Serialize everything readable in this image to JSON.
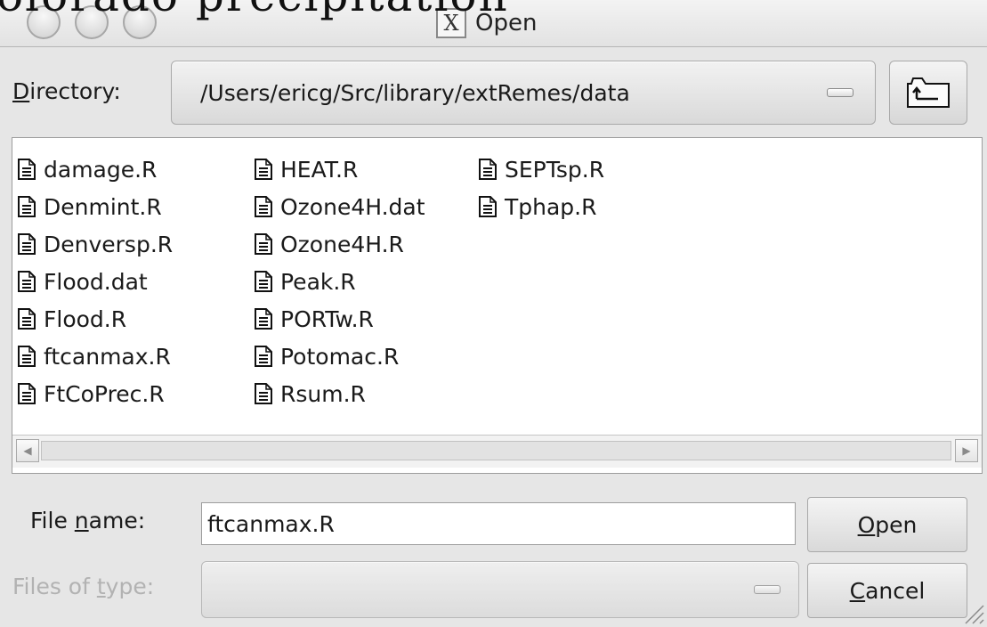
{
  "background_text": "olorado precipitation",
  "window": {
    "title": "Open",
    "title_icon": "x11-icon",
    "title_icon_glyph": "X"
  },
  "directory": {
    "label_mnemonic": "D",
    "label_rest": "irectory:",
    "path": "/Users/ericg/Src/library/extRemes/data",
    "up_button_icon": "folder-up-icon"
  },
  "files": {
    "columns": [
      [
        "damage.R",
        "Denmint.R",
        "Denversp.R",
        "Flood.dat",
        "Flood.R",
        "ftcanmax.R",
        "FtCoPrec.R"
      ],
      [
        "HEAT.R",
        "Ozone4H.dat",
        "Ozone4H.R",
        "Peak.R",
        "PORTw.R",
        "Potomac.R",
        "Rsum.R"
      ],
      [
        "SEPTsp.R",
        "Tphap.R"
      ]
    ]
  },
  "filename": {
    "label_prefix": "File ",
    "label_mnemonic": "n",
    "label_suffix": "ame:",
    "value": "ftcanmax.R"
  },
  "filetype": {
    "label_prefix": "Files of ",
    "label_mnemonic": "t",
    "label_suffix": "ype:",
    "value": ""
  },
  "buttons": {
    "open_mnemonic": "O",
    "open_rest": "pen",
    "cancel_mnemonic": "C",
    "cancel_rest": "ancel"
  }
}
